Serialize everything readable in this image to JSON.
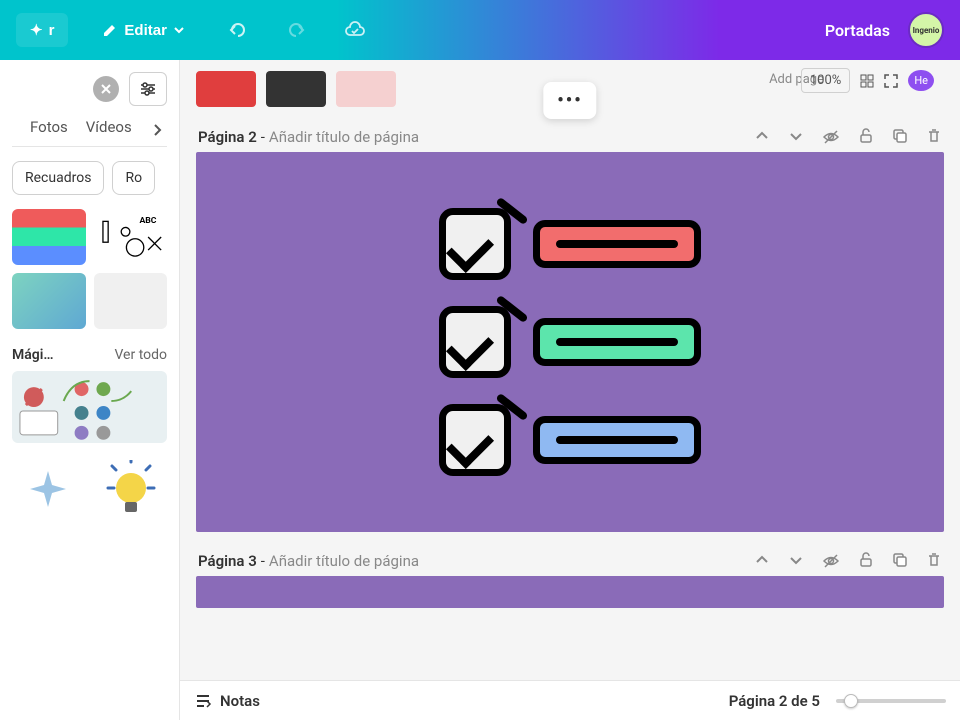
{
  "header": {
    "edit_label": "Editar",
    "doc_title": "Portadas",
    "avatar_label": "Ingenio"
  },
  "sidebar": {
    "tabs": {
      "photos": "Fotos",
      "videos": "Vídeos"
    },
    "chips": {
      "frames": "Recuadros",
      "ro": "Ro"
    },
    "magic": {
      "label": "Mági…",
      "see_all": "Ver todo"
    }
  },
  "toolbar": {
    "add_page_hint": "Add page",
    "zoom": "100%"
  },
  "page2": {
    "label": "Página 2",
    "sep": " - ",
    "hint": "Añadir título de página"
  },
  "page3": {
    "label": "Página 3",
    "sep": " - ",
    "hint": "Añadir título de página"
  },
  "footer": {
    "notes": "Notas",
    "pager": "Página 2 de 5"
  },
  "colors": {
    "purple_canvas": "#8a6bb8",
    "bar_red": "#f26d6d",
    "bar_green": "#5ce5ac",
    "bar_blue": "#8fb9f2"
  }
}
